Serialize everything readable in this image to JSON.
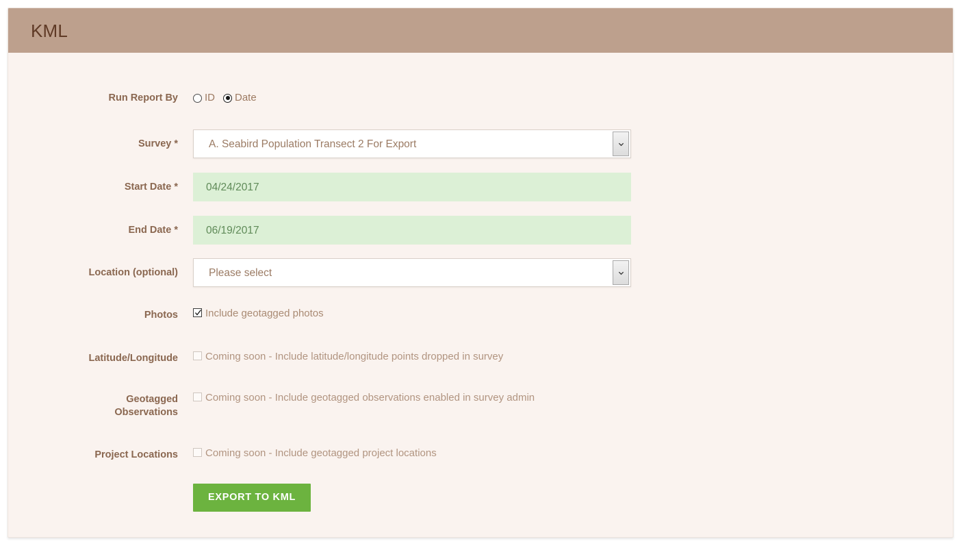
{
  "panel": {
    "title": "KML"
  },
  "form": {
    "run_report_by": {
      "label": "Run Report By",
      "options": [
        {
          "label": "ID",
          "checked": false
        },
        {
          "label": "Date",
          "checked": true
        }
      ]
    },
    "survey": {
      "label": "Survey *",
      "value": "A. Seabird Population Transect 2 For Export"
    },
    "start_date": {
      "label": "Start Date *",
      "value": "04/24/2017"
    },
    "end_date": {
      "label": "End Date *",
      "value": "06/19/2017"
    },
    "location": {
      "label": "Location (optional)",
      "value": "Please select"
    },
    "photos": {
      "label": "Photos",
      "checkbox_label": "Include geotagged photos",
      "checked": true
    },
    "lat_long": {
      "label": "Latitude/Longitude",
      "checkbox_label": "Coming soon - Include latitude/longitude points dropped in survey",
      "checked": false
    },
    "geotagged_observations": {
      "label_line1": "Geotagged",
      "label_line2": "Observations",
      "checkbox_label": "Coming soon - Include geotagged observations enabled in survey admin",
      "checked": false
    },
    "project_locations": {
      "label": "Project Locations",
      "checkbox_label": "Coming soon - Include geotagged project locations",
      "checked": false
    },
    "submit": {
      "label": "EXPORT TO KML"
    }
  },
  "colors": {
    "header_bg": "#bda08d",
    "panel_bg": "#faf3ef",
    "label_text": "#8a6750",
    "date_field_bg": "#dcf0d6",
    "submit_bg": "#6cb33f"
  },
  "icons": {
    "chevron_down": "chevron-down-icon",
    "checkmark": "checkmark-icon"
  }
}
